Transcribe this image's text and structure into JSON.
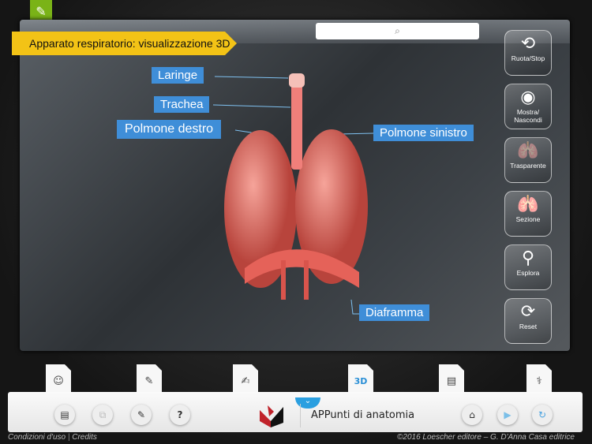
{
  "title": "Apparato respiratorio: visualizzazione 3D",
  "search": {
    "icon": "search-icon",
    "glyph": "⌕"
  },
  "controls": [
    {
      "label": "Ruota/Stop",
      "glyph": "⟲"
    },
    {
      "label": "Mostra/ Nascondi",
      "glyph": "◉"
    },
    {
      "label": "Trasparente",
      "glyph": "🫁"
    },
    {
      "label": "Sezione",
      "glyph": "🫁"
    },
    {
      "label": "Esplora",
      "glyph": "⚲"
    },
    {
      "label": "Reset",
      "glyph": "⟳"
    }
  ],
  "labels": {
    "laringe": "Laringe",
    "trachea": "Trachea",
    "polmone_destro": "Polmone destro",
    "polmone_sinistro": "Polmone sinistro",
    "diaframma": "Diaframma"
  },
  "tabs": [
    {
      "name": "anatomy",
      "glyph": "☺"
    },
    {
      "name": "quiz",
      "glyph": "✎"
    },
    {
      "name": "draw",
      "glyph": "✍"
    },
    {
      "name": "3d",
      "glyph": "3D"
    },
    {
      "name": "notes",
      "glyph": "▤"
    },
    {
      "name": "stethoscope",
      "glyph": "⚕"
    }
  ],
  "bottom": {
    "app_name": "APPunti di anatomia",
    "left_buttons": [
      "▤",
      "⧉",
      "✎",
      "?"
    ],
    "right_buttons": [
      "⌂",
      "▶",
      "↻"
    ],
    "expand": "⌄"
  },
  "footer": {
    "terms": "Condizioni d'uso",
    "credits": "Credits",
    "copyright": "©2016 Loescher editore – G. D'Anna Casa editrice"
  }
}
